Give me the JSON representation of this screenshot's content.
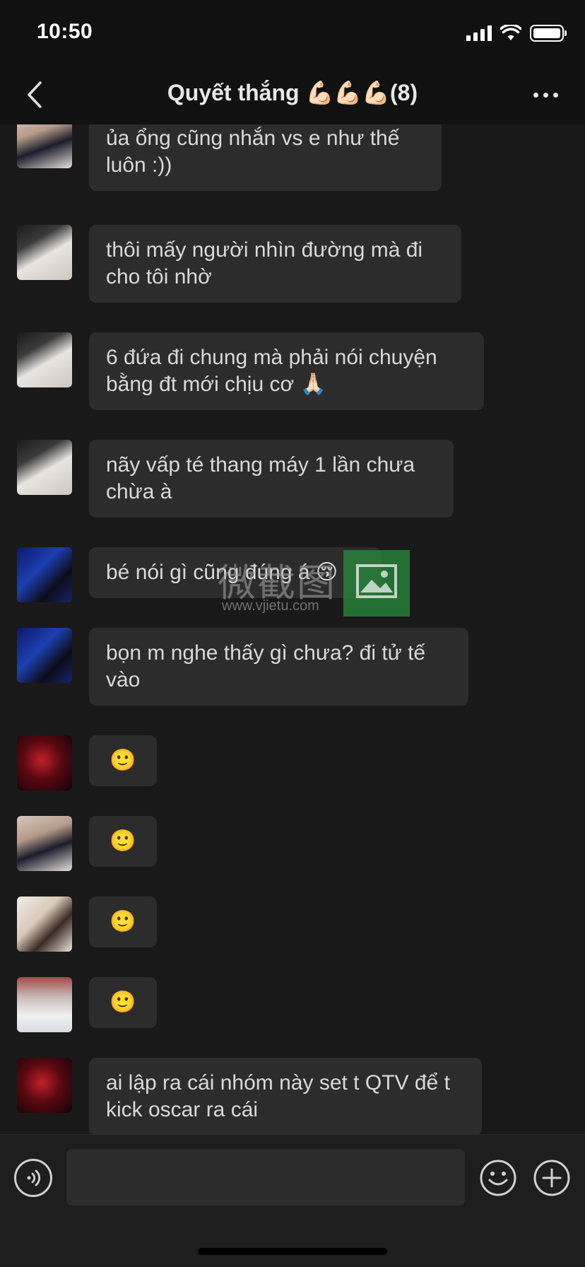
{
  "status_bar": {
    "time": "10:50",
    "icons": [
      "signal-icon",
      "wifi-icon",
      "battery-icon"
    ]
  },
  "header": {
    "title": "Quyết thắng 💪🏻💪🏻💪🏻(8)",
    "back_icon": "chevron-left-icon",
    "more_icon": "more-icon"
  },
  "messages": [
    {
      "avatar": "avatar-user-a",
      "text": "ủa ổng cũng nhắn vs e như thế luôn :))"
    },
    {
      "avatar": "avatar-user-b",
      "text": "thôi mấy người nhìn đường mà đi cho tôi nhờ"
    },
    {
      "avatar": "avatar-user-b",
      "text": "6 đứa đi chung mà phải nói chuyện bằng đt mới chịu cơ 🙏🏻"
    },
    {
      "avatar": "avatar-user-b",
      "text": "nãy vấp té thang máy 1 lần chưa chừa à"
    },
    {
      "avatar": "avatar-user-c",
      "text": "bé nói gì cũng đúng á 😚"
    },
    {
      "avatar": "avatar-user-c",
      "text": "bọn m nghe thấy gì chưa? đi tử tế vào"
    },
    {
      "avatar": "avatar-user-d",
      "text": "🙂"
    },
    {
      "avatar": "avatar-user-a",
      "text": "🙂"
    },
    {
      "avatar": "avatar-user-e",
      "text": "🙂"
    },
    {
      "avatar": "avatar-user-f",
      "text": "🙂"
    },
    {
      "avatar": "avatar-user-d",
      "text": "ai lập ra cái nhóm này set t QTV để t kick oscar ra cái"
    }
  ],
  "watermark": {
    "text": "微截图",
    "url": "www.vjietu.com"
  },
  "input_bar": {
    "placeholder": "",
    "voice_icon": "voice-icon",
    "emoji_icon": "emoji-icon",
    "plus_icon": "plus-icon"
  },
  "colors": {
    "background": "#191919",
    "header": "#111111",
    "bubble": "#2c2c2c",
    "text": "#d9d9d9"
  }
}
